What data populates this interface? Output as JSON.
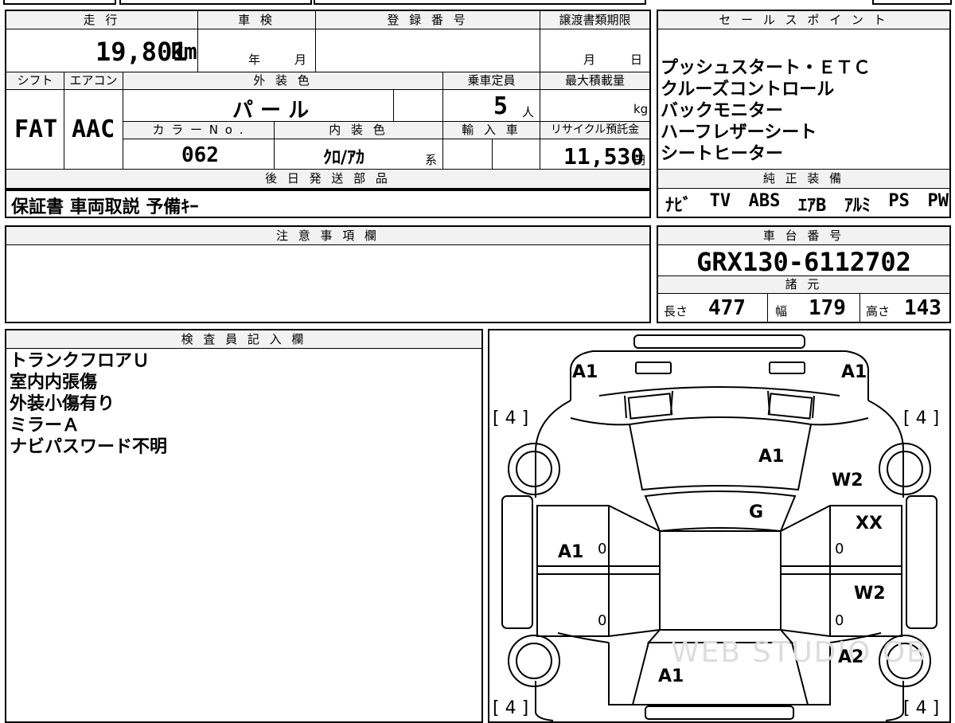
{
  "header": {
    "mileage_label": "走 行",
    "inspection_label": "車 検",
    "registration_label": "登 録 番 号",
    "transfer_deadline_label": "譲渡書類期限",
    "sales_points_label": "セ ー ル ス ポ イ ン ト"
  },
  "mileage": {
    "value": "19,801",
    "unit": "km"
  },
  "inspection": {
    "year_label": "年",
    "month_label": "月"
  },
  "transfer_deadline": {
    "month_label": "月",
    "day_label": "日"
  },
  "row2_labels": {
    "shift": "シフト",
    "aircon": "エアコン",
    "exterior_color": "外 装 色",
    "capacity": "乗車定員",
    "max_load": "最大積載量"
  },
  "shift": "FAT",
  "aircon": "AAC",
  "exterior_color": "パ ー ル",
  "capacity": {
    "value": "5",
    "unit": "人"
  },
  "max_load": {
    "unit": "kg"
  },
  "row3_labels": {
    "color_no": "カ ラ ー N o .",
    "interior_color": "内 装 色",
    "import": "輸 入 車",
    "recycle": "リサイクル預託金"
  },
  "color_no": "062",
  "interior_color": {
    "value": "ｸﾛ/ｱｶ",
    "suffix": "系"
  },
  "recycle_fee": {
    "value": "11,530",
    "unit": "円"
  },
  "sales_points": [
    "プッシュスタート・ＥＴＣ",
    "クルーズコントロール",
    "バックモニター",
    "ハーフレザーシート",
    "シートヒーター"
  ],
  "later_parts": {
    "label": "後 日 発 送 部 品",
    "value": "保証書 車両取説 予備ｷｰ"
  },
  "standard_equipment": {
    "label": "純 正 装 備",
    "items": [
      "ﾅﾋﾞ",
      "TV",
      "ABS",
      "ｴｱB",
      "ｱﾙﾐ",
      "PS",
      "PW"
    ]
  },
  "notes": {
    "label": "注 意 事 項 欄"
  },
  "chassis": {
    "label": "車 台 番 号",
    "value": "GRX130-6112702"
  },
  "specs": {
    "label": "諸 元",
    "length_label": "長さ",
    "length": "477",
    "width_label": "幅",
    "width": "179",
    "height_label": "高さ",
    "height": "143"
  },
  "inspector": {
    "label": "検 査 員 記 入 欄",
    "lines": [
      "トランクフロアＵ",
      "室内内張傷",
      "外装小傷有り",
      "ミラーＡ",
      "ナビパスワード不明"
    ]
  },
  "diagram": {
    "marks": {
      "front_left": "A1",
      "front_right": "A1",
      "tire_fl": "[ 4 ]",
      "tire_fr": "[ 4 ]",
      "tire_rl": "[ 4 ]",
      "tire_rr": "[ 4 ]",
      "hood": "A1",
      "windshield": "G",
      "fender_fr": "W2",
      "door_fr": "XX",
      "door_rr": "W2",
      "quarter_rr": "A2",
      "door_fl": "A1",
      "trunk": "A1",
      "zero_fl": "0",
      "zero_rl": "0",
      "zero_fr": "0",
      "zero_rr": "0"
    },
    "watermark": "WEB STUDIO OB"
  }
}
